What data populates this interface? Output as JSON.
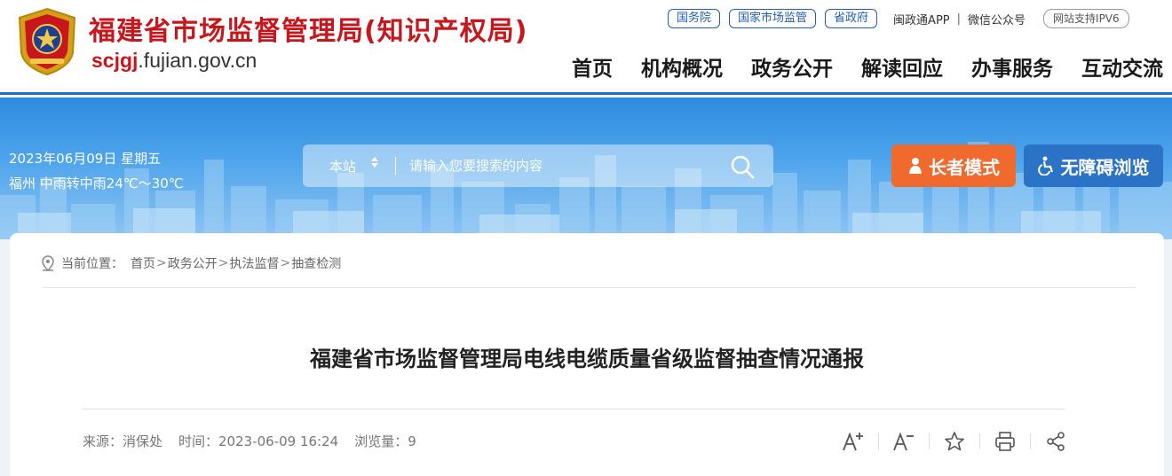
{
  "header": {
    "site_title": "福建省市场监督管理局(知识产权局)",
    "domain_highlight": "scjgj",
    "domain_rest": ".fujian.gov.cn",
    "top_links": {
      "guowuyuan": "国务院",
      "guojia_scjg": "国家市场监管",
      "shengzhengfu": "省政府",
      "minzhengtong": "闽政通APP",
      "separator": "|",
      "weixin": "微信公众号",
      "ipv6": "网站支持IPV6"
    },
    "nav": [
      "首页",
      "机构概况",
      "政务公开",
      "解读回应",
      "办事服务",
      "互动交流"
    ]
  },
  "banner": {
    "date": "2023年06月09日 星期五",
    "weather": "福州 中雨转中雨24℃～30℃",
    "search": {
      "scope": "本站",
      "placeholder": "请输入您要搜索的内容"
    },
    "elder_mode": "长者模式",
    "accessible": "无障碍浏览"
  },
  "breadcrumb": {
    "label": "当前位置：",
    "items": [
      "首页",
      "政务公开",
      "执法监督",
      "抽查检测"
    ],
    "arrow": ">"
  },
  "article": {
    "title": "福建省市场监督管理局电线电缆质量省级监督抽查情况通报",
    "source": "来源：消保处",
    "time": "时间：2023-06-09 16:24",
    "views": "浏览量：9"
  },
  "colors": {
    "brand_red": "#c8161d",
    "brand_blue": "#1f6fc4",
    "elder_orange": "#f06a2e",
    "access_blue": "#2a73c7"
  },
  "icons": [
    "national-emblem-icon",
    "search-icon",
    "elder-icon",
    "wheelchair-icon",
    "location-pin-icon",
    "font-increase-icon",
    "font-decrease-icon",
    "star-icon",
    "print-icon",
    "share-icon"
  ]
}
